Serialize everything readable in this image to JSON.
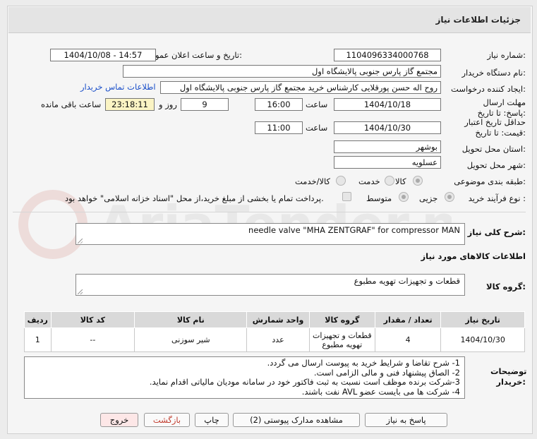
{
  "title": "جزئیات اطلاعات نیاز",
  "labels": {
    "need_number": "شماره نیاز:",
    "announce_datetime": "تاریخ و ساعت اعلان عمومی:",
    "buyer_name": "نام دستگاه خریدار:",
    "requester": "ایجاد کننده درخواست:",
    "reply_deadline": "مهلت ارسال پاسخ: تا تاریخ:",
    "hour1": "ساعت",
    "day_and": "روز و",
    "remaining": "ساعت باقی مانده",
    "price_validity": "حداقل تاریخ اعتبار قیمت: تا تاریخ:",
    "hour2": "ساعت",
    "province": "استان محل تحویل:",
    "city": "شهر محل تحویل:",
    "category": "طبقه بندی موضوعی:",
    "purchase_type": "نوع فرآیند خرید :",
    "description": "شرح کلی نیاز:",
    "goods_info": "اطلاعات کالاهای مورد نیاز",
    "goods_group": "گروه کالا:",
    "buyer_notes": "توضیحات خریدار:"
  },
  "values": {
    "need_number": "1104096334000768",
    "announce_datetime": "1404/10/08 - 14:57",
    "buyer_name": "مجتمع گاز پارس جنوبی  پالایشگاه اول",
    "requester": "روح اله حسن پورقلایی کارشناس خرید مجتمع گاز پارس جنوبی  پالایشگاه اول",
    "contact_link": "اطلاعات تماس خریدار",
    "reply_date": "1404/10/18",
    "reply_time": "16:00",
    "days": "9",
    "remaining_time": "23:18:11",
    "validity_date": "1404/10/30",
    "validity_time": "11:00",
    "province": "بوشهر",
    "city": "عسلویه",
    "description": "needle valve \"MHA ZENTGRAF\" for compressor MAN",
    "goods_group": "قطعات و تجهیزات تهویه مطبوع"
  },
  "category_options": [
    "کالا",
    "خدمت",
    "کالا/خدمت"
  ],
  "category_selected": "کالا",
  "purchase_options": [
    "جزیی",
    "متوسط"
  ],
  "purchase_selected": "جزیی",
  "payment_note": "پرداخت تمام یا بخشی از مبلغ خرید،از محل \"اسناد خزانه اسلامی\" خواهد بود.",
  "table": {
    "headers": [
      "ردیف",
      "کد کالا",
      "نام کالا",
      "واحد شمارش",
      "گروه کالا",
      "تعداد / مقدار",
      "تاریخ نیاز"
    ],
    "rows": [
      [
        "1",
        "--",
        "شیر سوزنی",
        "عدد",
        "قطعات و تجهیزات تهویه مطبوع",
        "4",
        "1404/10/30"
      ]
    ]
  },
  "notes": [
    "1- شرح تقاضا و شرایط خرید به پیوست ارسال می گردد.",
    "2- الصاق پیشنهاد فنی و مالی الزامی است.",
    "3-شرکت برنده موظف است نسبت به ثبت فاکتور خود در سامانه مودیان مالیاتی اقدام نماید.",
    "4- شرکت ها می بایست عضو AVL نفت باشند."
  ],
  "buttons": {
    "reply": "پاسخ به نیاز",
    "view_docs": "مشاهده مدارک پیوستی (2)",
    "print": "چاپ",
    "back": "بازگشت",
    "exit": "خروج"
  },
  "watermark": "AriaTender.net",
  "colors": {
    "yellow_field": "#fbf4c4",
    "link": "#1a4fc9",
    "back_text": "#c0392b",
    "exit_bg": "#fde7e7"
  }
}
